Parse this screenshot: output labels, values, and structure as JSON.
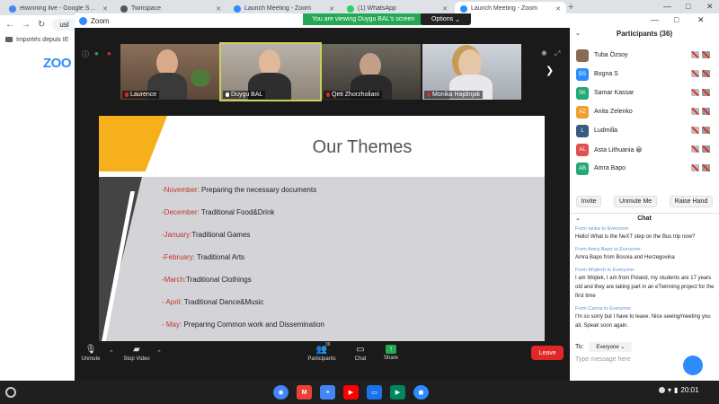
{
  "browser": {
    "tabs": [
      {
        "label": "etwinning live - Google Search",
        "favicon_color": "#4285f4"
      },
      {
        "label": "Twinspace",
        "favicon_color": "#555555"
      },
      {
        "label": "Launch Meeting - Zoom",
        "favicon_color": "#2d8cff"
      },
      {
        "label": "(1) WhatsApp",
        "favicon_color": "#25d366"
      },
      {
        "label": "Launch Meeting - Zoom",
        "favicon_color": "#2d8cff",
        "active": true
      }
    ],
    "address_partial": "usl",
    "bookmark_label": "Importés depuis IE",
    "page_logo_partial": "ZOO"
  },
  "zoom": {
    "window_title": "Zoom",
    "viewing_banner": "You are viewing Duygu BAL's screen",
    "options_label": "Options",
    "participants_thumbs": [
      {
        "name": "Laurence"
      },
      {
        "name": "Duygu BAL",
        "active": true
      },
      {
        "name": "Qeti Zhorzholiani"
      },
      {
        "name": "Monika Hajdinjak"
      }
    ],
    "slide": {
      "title": "Our Themes",
      "themes": [
        {
          "month": "-November:",
          "text": " Preparing the necessary documents"
        },
        {
          "month": "-December:",
          "text": " Traditional Food&Drink"
        },
        {
          "month": "-January:",
          "text": "Traditional Games"
        },
        {
          "month": "-February:",
          "text": " Traditional Arts"
        },
        {
          "month": "-March:",
          "text": "Traditional Clothings"
        },
        {
          "month": "- April:",
          "text": " Traditional Dance&Music"
        },
        {
          "month": "- May:",
          "text": " Preparing Common work and Dissemination"
        }
      ]
    },
    "controls": {
      "unmute": "Unmute",
      "stop_video": "Stop Video",
      "participants": "Participants",
      "participants_count": "36",
      "chat": "Chat",
      "share": "Share",
      "leave": "Leave"
    }
  },
  "panel": {
    "title": "Participants (36)",
    "participants": [
      {
        "initials": "",
        "name": "Tuba Özsoy",
        "color": "#8a6a55",
        "photo": true
      },
      {
        "initials": "BS",
        "name": "Bogna S",
        "color": "#2d8cff"
      },
      {
        "initials": "SK",
        "name": "Samar Kassar",
        "color": "#24a876"
      },
      {
        "initials": "AZ",
        "name": "Anita Zelenko",
        "color": "#f0a030"
      },
      {
        "initials": "L",
        "name": "Ludmilla",
        "color": "#3a5a80"
      },
      {
        "initials": "AL",
        "name": "Asta Lithuania 😀",
        "color": "#e05050"
      },
      {
        "initials": "AB",
        "name": "Amra Bapo",
        "color": "#24a876"
      }
    ],
    "buttons": {
      "invite": "Invite",
      "unmute_me": "Unmute Me",
      "raise_hand": "Raise Hand"
    },
    "chat_title": "Chat",
    "messages": [
      {
        "from": "From Ianka to Everyone:",
        "body": "Hello! What is the NeXT step on the Bus trip now?"
      },
      {
        "from": "From Amra Bapo to Everyone:",
        "body": "Amra Bapo from Bosnia and Herzegovina"
      },
      {
        "from": "From Wojtech to Everyone:",
        "body": "I am Wojtek, I am from Poland, my students are 17 years old and they are taking part in an eTwinning project for the first time"
      },
      {
        "from": "From Carina to Everyone:",
        "body": "I'm so sorry but I have to leave. Nice seeing/meeting you all. Speak soon again."
      }
    ],
    "to_label": "To:",
    "to_value": "Everyone",
    "type_placeholder": "Type message here"
  },
  "taskbar": {
    "apps": [
      {
        "name": "chrome-icon",
        "color": "#4285f4",
        "glyph": "◉"
      },
      {
        "name": "gmail-icon",
        "color": "#ea4335",
        "glyph": "M"
      },
      {
        "name": "docs-icon",
        "color": "#4285f4",
        "glyph": "≡"
      },
      {
        "name": "youtube-icon",
        "color": "#ff0000",
        "glyph": "▶"
      },
      {
        "name": "files-icon",
        "color": "#1a73e8",
        "glyph": "▭"
      },
      {
        "name": "play-store-icon",
        "color": "#01875f",
        "glyph": "▶"
      },
      {
        "name": "zoom-app-icon",
        "color": "#2d8cff",
        "glyph": "◼"
      }
    ],
    "clock": "20:01"
  }
}
